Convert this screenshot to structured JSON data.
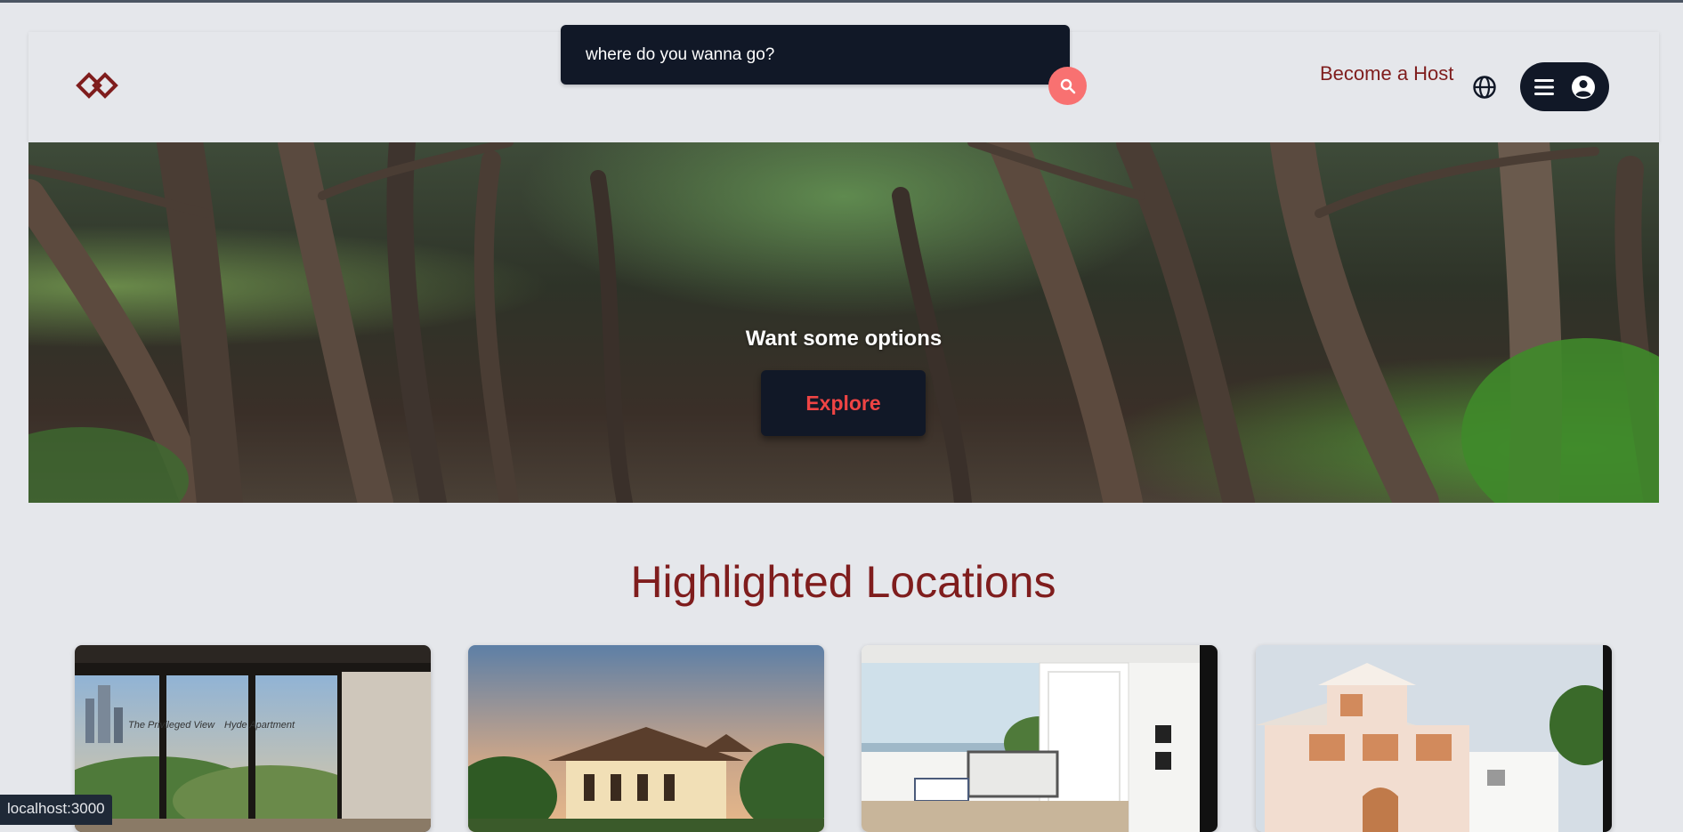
{
  "header": {
    "logo_icon": "linked-diamonds-logo",
    "search": {
      "placeholder": "where do you wanna go?",
      "button_icon": "search-icon"
    },
    "host_link": "Become a Host",
    "globe_icon": "globe-icon",
    "menu_icon": "hamburger-icon",
    "user_icon": "user-circle-icon"
  },
  "hero": {
    "title": "Want some options",
    "button_label": "Explore"
  },
  "highlights": {
    "title": "Highlighted Locations",
    "cards": [
      {
        "image": "apartment-interior-city-view",
        "caption_left": "The Privileged View",
        "caption_right": "Hyde Apartment"
      },
      {
        "image": "tropical-resort-house-sunset"
      },
      {
        "image": "white-bedroom-ocean-balcony"
      },
      {
        "image": "white-villa-exterior"
      }
    ]
  },
  "status_bar": {
    "url": "localhost:3000"
  },
  "colors": {
    "brand": "#7f1d1d",
    "dark": "#111827",
    "accent": "#f87171",
    "explore_text": "#ef4444",
    "background": "#e5e7eb"
  }
}
